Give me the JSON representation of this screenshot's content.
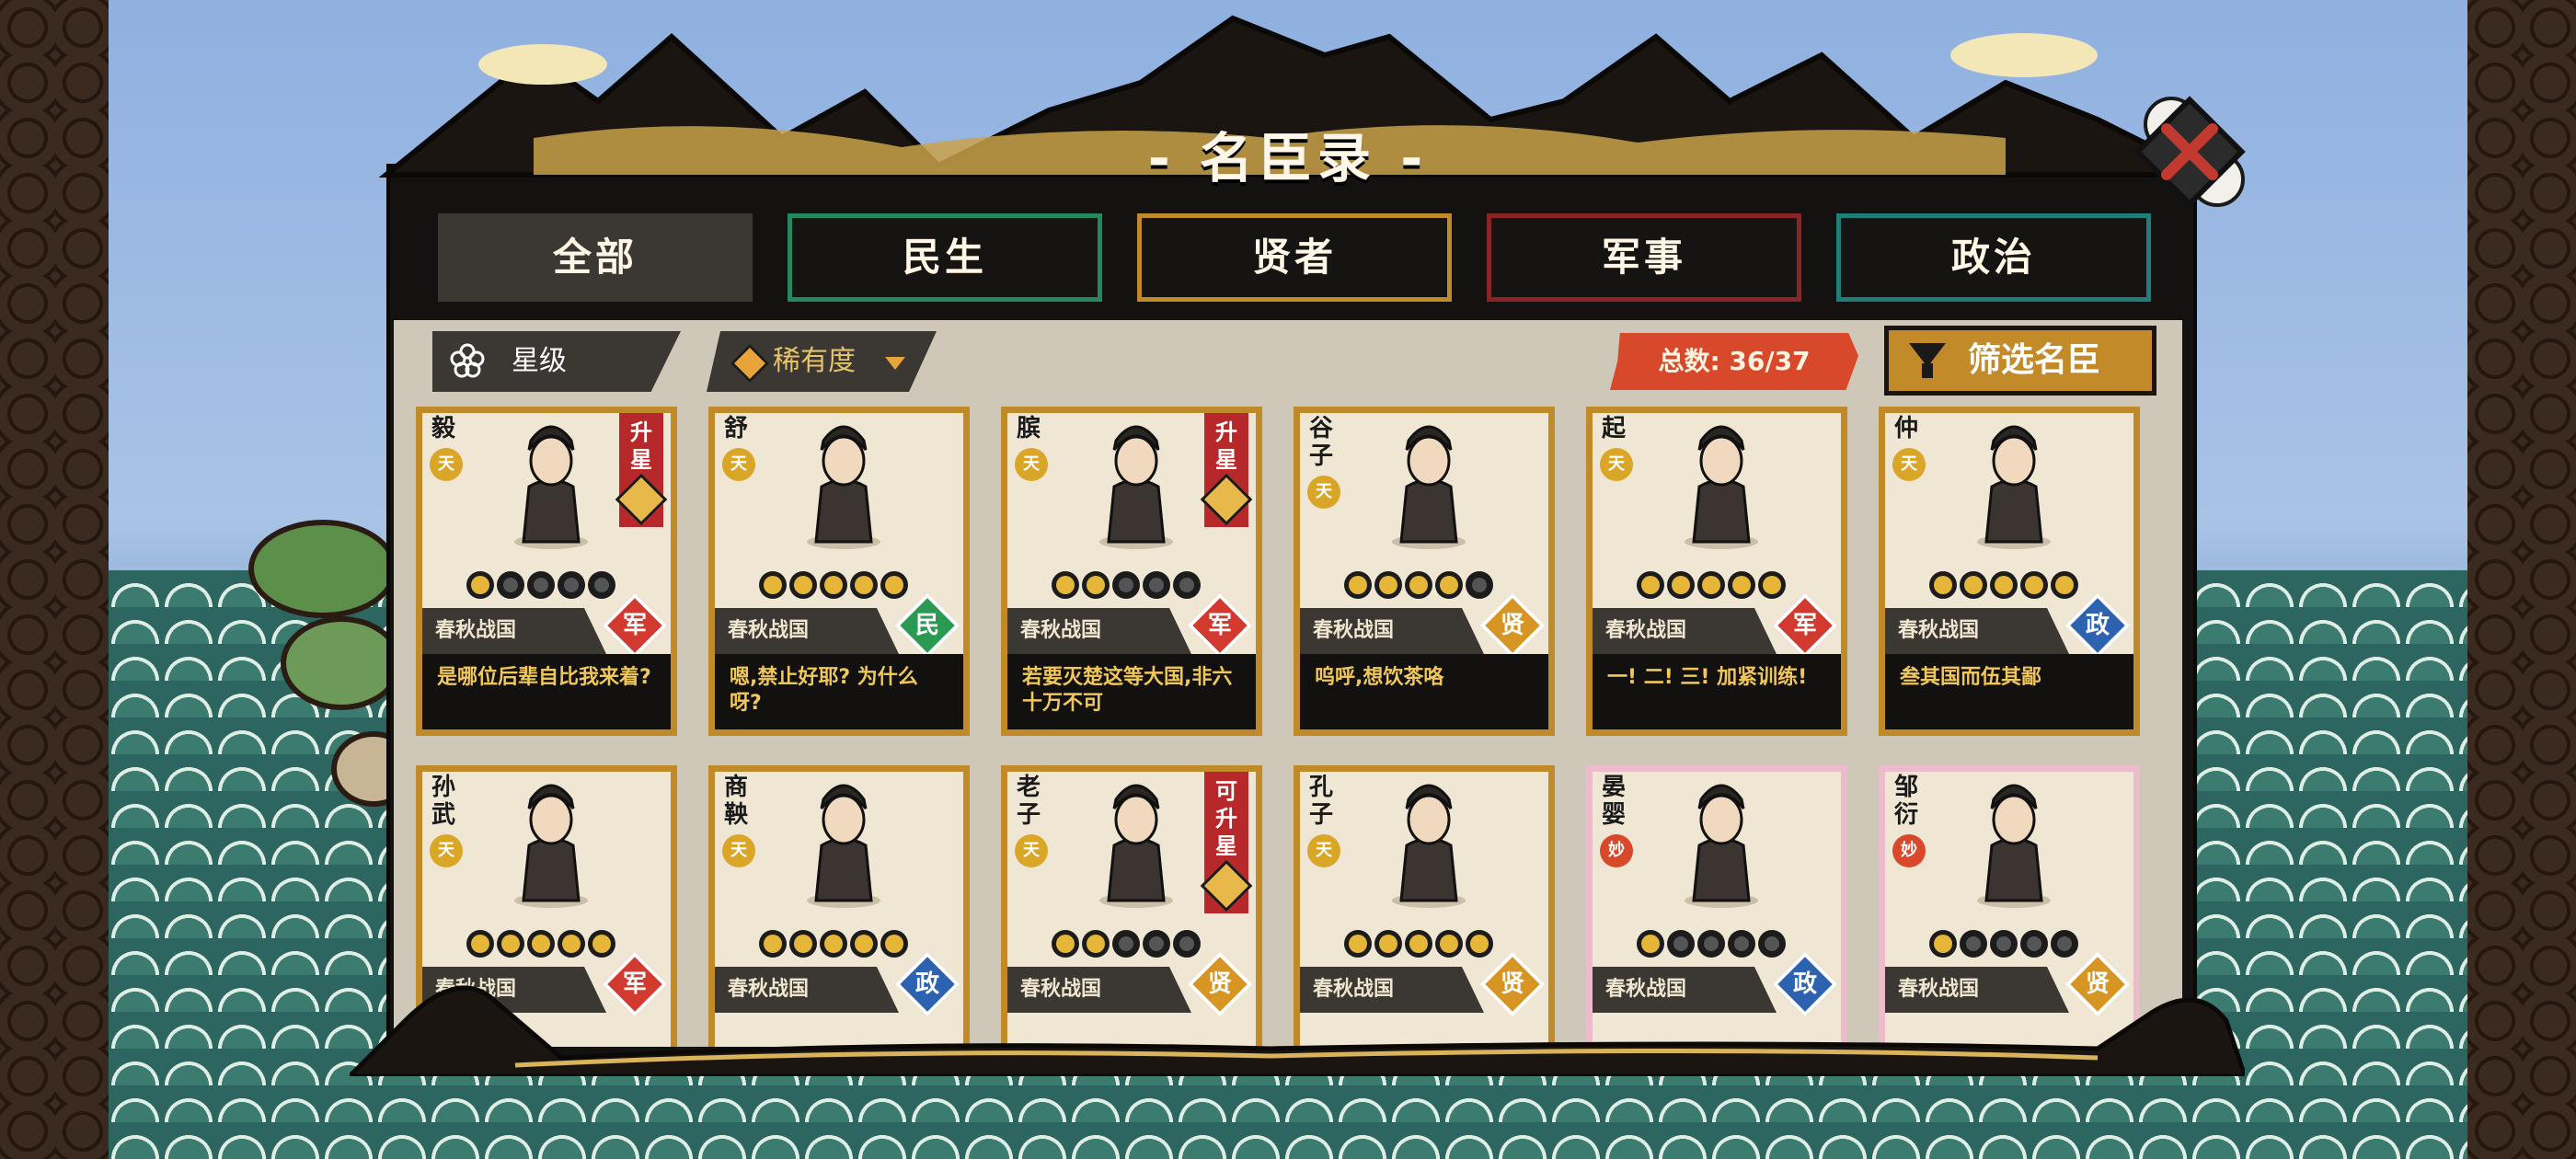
{
  "title": "- 名臣录 -",
  "tabs": [
    "全部",
    "民生",
    "贤者",
    "军事",
    "政治"
  ],
  "toolbar": {
    "sort_star_label": "星级",
    "sort_rarity_label": "稀有度",
    "total_label": "总数: 36/37",
    "filter_label": "筛选名臣"
  },
  "colors": {
    "gold": "#c08a28",
    "mil": "#d23a2f",
    "people": "#2a9a52",
    "sage": "#d79624",
    "politics": "#2d62b0"
  },
  "cards": [
    {
      "name": "毅",
      "rank": "天",
      "stars": 1,
      "era": "春秋战国",
      "category": "军",
      "upgrade": "升星",
      "quote": "是哪位后辈自比我来着?"
    },
    {
      "name": "舒",
      "rank": "天",
      "stars": 5,
      "era": "春秋战国",
      "category": "民",
      "upgrade": "",
      "quote": "嗯,禁止好耶? 为什么呀?"
    },
    {
      "name": "膑",
      "rank": "天",
      "stars": 2,
      "era": "春秋战国",
      "category": "军",
      "upgrade": "升星",
      "quote": "若要灭楚这等大国,非六十万不可"
    },
    {
      "name": "谷子",
      "rank": "天",
      "stars": 4,
      "era": "春秋战国",
      "category": "贤",
      "upgrade": "",
      "quote": "呜呼,想饮茶咯"
    },
    {
      "name": "起",
      "rank": "天",
      "stars": 5,
      "era": "春秋战国",
      "category": "军",
      "upgrade": "",
      "quote": "一! 二! 三! 加紧训练!"
    },
    {
      "name": "仲",
      "rank": "天",
      "stars": 5,
      "era": "春秋战国",
      "category": "政",
      "upgrade": "",
      "quote": "叁其国而伍其鄙"
    },
    {
      "name": "孙武",
      "rank": "天",
      "stars": 5,
      "era": "春秋战国",
      "category": "军",
      "upgrade": "",
      "quote": ""
    },
    {
      "name": "商鞅",
      "rank": "天",
      "stars": 5,
      "era": "春秋战国",
      "category": "政",
      "upgrade": "",
      "quote": ""
    },
    {
      "name": "老子",
      "rank": "天",
      "stars": 2,
      "era": "春秋战国",
      "category": "贤",
      "upgrade": "可升星",
      "quote": ""
    },
    {
      "name": "孔子",
      "rank": "天",
      "stars": 5,
      "era": "春秋战国",
      "category": "贤",
      "upgrade": "",
      "quote": ""
    },
    {
      "name": "晏婴",
      "rank": "妙",
      "stars": 1,
      "era": "春秋战国",
      "category": "政",
      "upgrade": "",
      "quote": ""
    },
    {
      "name": "邹衍",
      "rank": "妙",
      "stars": 1,
      "era": "春秋战国",
      "category": "贤",
      "upgrade": "",
      "quote": ""
    }
  ]
}
